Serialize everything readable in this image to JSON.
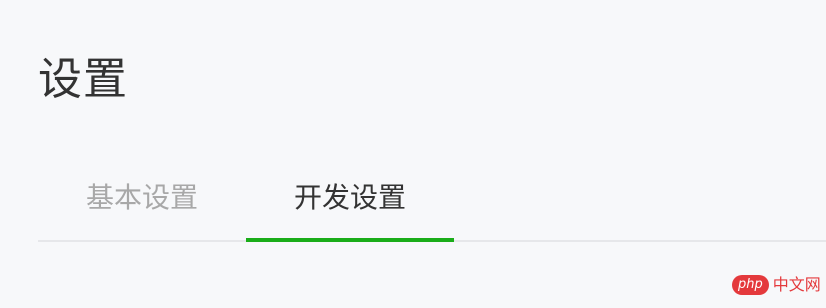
{
  "page": {
    "title": "设置"
  },
  "tabs": [
    {
      "label": "基本设置",
      "active": false
    },
    {
      "label": "开发设置",
      "active": true
    }
  ],
  "colors": {
    "background": "#f7f8fa",
    "active_text": "#333333",
    "inactive_text": "#a8a8a8",
    "accent": "#1aad19",
    "divider": "#e6e7ea",
    "watermark": "#e4393c"
  },
  "watermark": {
    "badge": "php",
    "text": "中文网"
  }
}
